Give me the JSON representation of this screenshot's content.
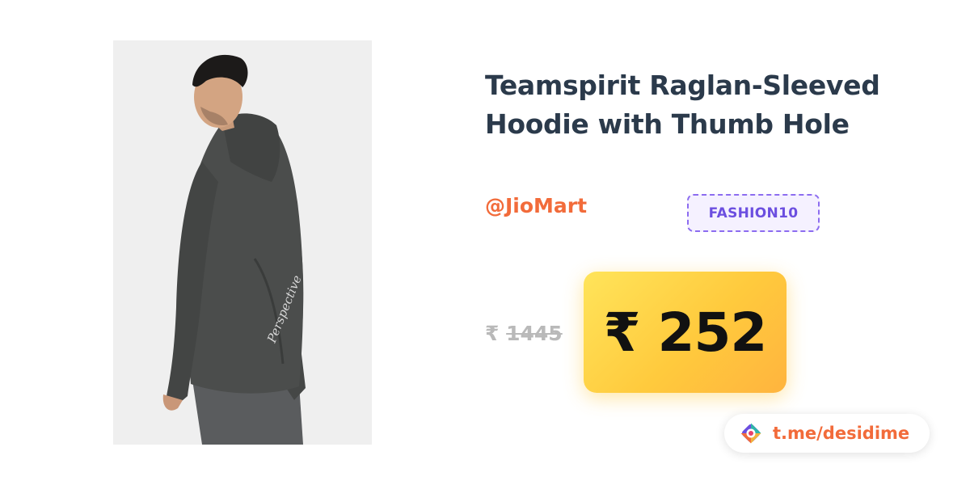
{
  "product": {
    "title": "Teamspirit Raglan-Sleeved Hoodie with Thumb Hole",
    "image_alt_subject": "man wearing dark grey hoodie",
    "print_text": "Perspective"
  },
  "store": {
    "handle": "@JioMart"
  },
  "coupon": {
    "code": "FASHION10"
  },
  "pricing": {
    "currency_symbol": "₹",
    "original_price": "1445",
    "deal_price": "₹ 252"
  },
  "footer": {
    "telegram_link": "t.me/desidime"
  },
  "colors": {
    "title": "#2b3a4b",
    "accent_orange": "#f26b3a",
    "coupon_purple": "#6c4fe0",
    "price_gradient_start": "#ffe45a",
    "price_gradient_end": "#ffb43e",
    "hoodie": "#4a4c4b"
  }
}
